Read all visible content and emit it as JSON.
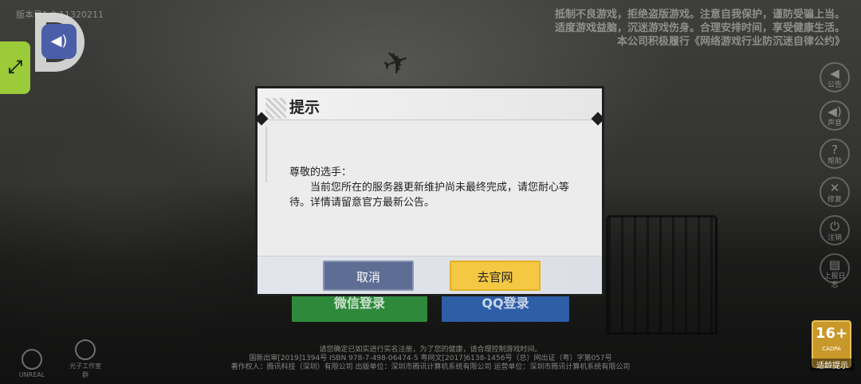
{
  "background": {
    "version_text": "版本号1.0.11320211",
    "notice_lines": [
      "抵制不良游戏，拒绝盗版游戏。注意自我保护，谨防受骗上当。",
      "适度游戏益脑，沉迷游戏伤身。合理安排时间，享受健康生活。",
      "本公司积极履行《网络游戏行业防沉迷自律公约》"
    ],
    "side_menu": [
      {
        "icon": "announcement-icon",
        "glyph": "◀",
        "label": "公告"
      },
      {
        "icon": "sound-icon",
        "glyph": "◀)",
        "label": "声音"
      },
      {
        "icon": "help-icon",
        "glyph": "?",
        "label": "帮助"
      },
      {
        "icon": "repair-icon",
        "glyph": "✕",
        "label": "修复"
      },
      {
        "icon": "power-icon",
        "glyph": "⏻",
        "label": "注销"
      },
      {
        "icon": "report-icon",
        "glyph": "▤",
        "label": "上报日志"
      }
    ],
    "login_wechat": "微信登录",
    "login_qq": "QQ登录",
    "age_rating": {
      "number": "16+",
      "sub": "CADPA",
      "label": "适龄提示"
    },
    "footer_logos": [
      {
        "name": "unreal-logo",
        "label": "UNREAL"
      },
      {
        "name": "studio-logo",
        "label": "光子工作室群"
      }
    ],
    "footer_lines": [
      "请您确定已如实进行实名注册，为了您的健康，请合理控制游戏时间。",
      "国新出审[2019]1394号  ISBN 978-7-498-06474-5  粤网文[2017]6138-1456号（总）网出证（粤）字第057号",
      "著作权人：腾讯科技（深圳）有限公司  出版单位：深圳市腾讯计算机系统有限公司  运营单位：深圳市腾讯计算机系统有限公司"
    ]
  },
  "overlay": {
    "speaker_glyph": "◀)",
    "expand_glyph": "⤢"
  },
  "dialog": {
    "title": "提示",
    "greeting": "尊敬的选手：",
    "message": "当前您所在的服务器更新维护尚未最终完成，请您耐心等待。详情请留意官方最新公告。",
    "cancel_label": "取消",
    "official_label": "去官网",
    "colors": {
      "cancel": "#5e6d93",
      "official": "#f5c843"
    }
  }
}
